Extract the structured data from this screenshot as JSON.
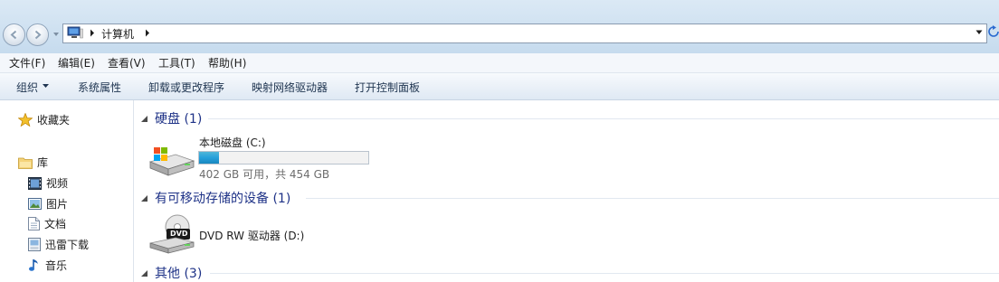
{
  "address": {
    "breadcrumb": "计算机"
  },
  "menu": [
    "文件(F)",
    "编辑(E)",
    "查看(V)",
    "工具(T)",
    "帮助(H)"
  ],
  "commands": {
    "organize": "组织",
    "system_properties": "系统属性",
    "uninstall": "卸载或更改程序",
    "map_drive": "映射网络驱动器",
    "control_panel": "打开控制面板"
  },
  "nav": {
    "favorites": "收藏夹",
    "libraries": "库",
    "videos": "视频",
    "pictures": "图片",
    "documents": "文档",
    "downloads": "迅雷下载",
    "music": "音乐"
  },
  "groups": {
    "hdd": "硬盘 (1)",
    "removable": "有可移动存储的设备 (1)",
    "other": "其他 (3)"
  },
  "drive_c": {
    "name": "本地磁盘 (C:)",
    "free_text": "402 GB 可用，共 454 GB",
    "used_fraction": 0.115
  },
  "drive_d": {
    "name": "DVD RW 驱动器 (D:)",
    "icon_label": "DVD"
  },
  "colors": {
    "group_header": "#1e3287",
    "bar_fill": "#26a0da"
  }
}
